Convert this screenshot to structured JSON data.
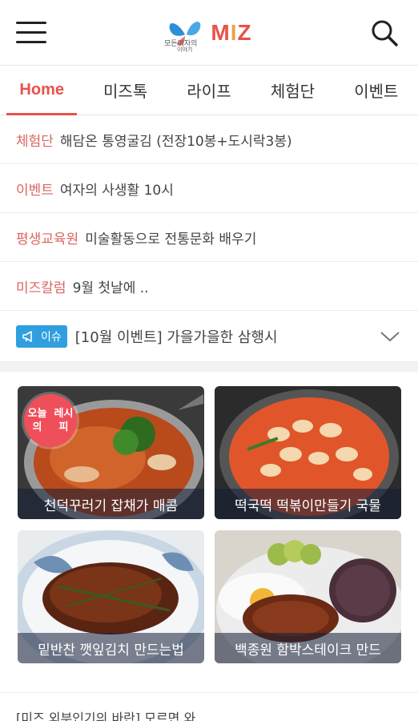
{
  "header": {
    "logo_text": "MIZ",
    "logo_small_text": "모든여자의 이야기"
  },
  "tabs": [
    {
      "label": "Home",
      "active": true
    },
    {
      "label": "미즈톡",
      "active": false
    },
    {
      "label": "라이프",
      "active": false
    },
    {
      "label": "체험단",
      "active": false
    },
    {
      "label": "이벤트",
      "active": false
    }
  ],
  "news": [
    {
      "category": "체험단",
      "text": "해담온 통영굴김 (전장10봉+도시락3봉)"
    },
    {
      "category": "이벤트",
      "text": "여자의 사생활 10시"
    },
    {
      "category": "평생교육원",
      "text": "미술활동으로 전통문화 배우기"
    },
    {
      "category": "미즈칼럼",
      "text": "9월 첫날에 .."
    }
  ],
  "issue": {
    "badge": "이슈",
    "text": "[10월 이벤트] 가을가을한 삼행시"
  },
  "cards": [
    {
      "caption": "천덕꾸러기 잡채가 매콤",
      "badge": "오늘의 레시피"
    },
    {
      "caption": "떡국떡 떡볶이만들기 국물"
    },
    {
      "caption": "밑반찬 깻잎김치 만드는법"
    },
    {
      "caption": "백종원 함박스테이크 만드"
    }
  ],
  "bottom_peek": "[미즈 외부인기의 바란] 모르면 와",
  "colors": {
    "accent": "#e8524a",
    "category": "#d9665e",
    "issue_badge": "#2f9fe0"
  }
}
